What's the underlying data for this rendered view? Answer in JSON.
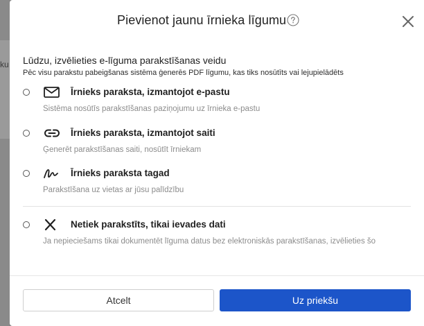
{
  "background": {
    "partial_text": "ku"
  },
  "dialog": {
    "title": "Pievienot jaunu īrnieka līgumu",
    "help_icon": "question-circle-icon",
    "close_icon": "close-icon"
  },
  "section": {
    "title": "Lūdzu, izvēlieties e-līguma parakstīšanas veidu",
    "subtitle": "Pēc visu parakstu pabeigšanas sistēma ģenerēs PDF līgumu, kas tiks nosūtīts vai lejupielādēts"
  },
  "options": [
    {
      "icon": "envelope-icon",
      "label": "Īrnieks paraksta, izmantojot e-pastu",
      "description": "Sistēma nosūtīs parakstīšanas paziņojumu uz īrnieka e-pastu",
      "selected": false
    },
    {
      "icon": "link-icon",
      "label": "Īrnieks paraksta, izmantojot saiti",
      "description": "Ģenerēt parakstīšanas saiti, nosūtīt īrniekam",
      "selected": false
    },
    {
      "icon": "signature-icon",
      "label": "Īrnieks paraksta tagad",
      "description": "Parakstīšana uz vietas ar jūsu palīdzību",
      "selected": false
    },
    {
      "icon": "x-mark-icon",
      "label": "Netiek parakstīts, tikai ievades dati",
      "description": "Ja nepieciešams tikai dokumentēt līguma datus bez elektroniskās parakstīšanas, izvēlieties šo",
      "selected": false
    }
  ],
  "footer": {
    "cancel_label": "Atcelt",
    "next_label": "Uz priekšu"
  },
  "colors": {
    "primary": "#1c55c9",
    "overlay": "#7d7d7d",
    "muted_text": "#8c8c8c"
  }
}
